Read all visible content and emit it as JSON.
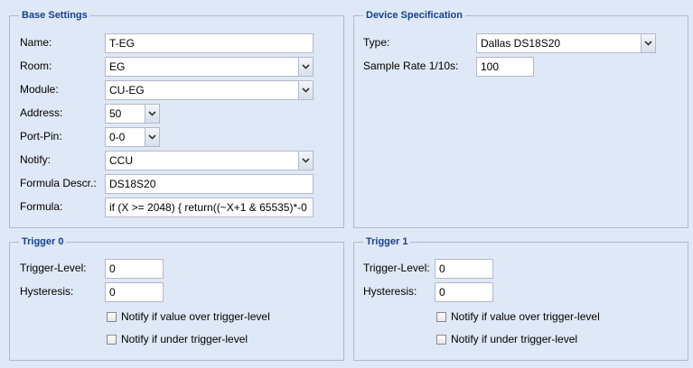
{
  "base_settings": {
    "title": "Base Settings",
    "name_label": "Name:",
    "name_value": "T-EG",
    "room_label": "Room:",
    "room_value": "EG",
    "module_label": "Module:",
    "module_value": "CU-EG",
    "address_label": "Address:",
    "address_value": "50",
    "port_pin_label": "Port-Pin:",
    "port_pin_value": "0-0",
    "notify_label": "Notify:",
    "notify_value": "CCU",
    "formula_descr_label": "Formula Descr.:",
    "formula_descr_value": "DS18S20",
    "formula_label": "Formula:",
    "formula_value": "if (X >= 2048) { return((~X+1 & 65535)*-0"
  },
  "device_spec": {
    "title": "Device Specification",
    "type_label": "Type:",
    "type_value": "Dallas DS18S20",
    "sample_rate_label": "Sample Rate 1/10s:",
    "sample_rate_value": "100"
  },
  "trigger0": {
    "title": "Trigger 0",
    "level_label": "Trigger-Level:",
    "level_value": "0",
    "hysteresis_label": "Hysteresis:",
    "hysteresis_value": "0",
    "notify_over_label": "Notify if value over trigger-level",
    "notify_under_label": "Notify if under trigger-level"
  },
  "trigger1": {
    "title": "Trigger 1",
    "level_label": "Trigger-Level:",
    "level_value": "0",
    "hysteresis_label": "Hysteresis:",
    "hysteresis_value": "0",
    "notify_over_label": "Notify if value over trigger-level",
    "notify_under_label": "Notify if under trigger-level"
  },
  "icons": {
    "combo_trigger": "chevron-down-icon",
    "checkbox": "checkbox-unchecked"
  }
}
